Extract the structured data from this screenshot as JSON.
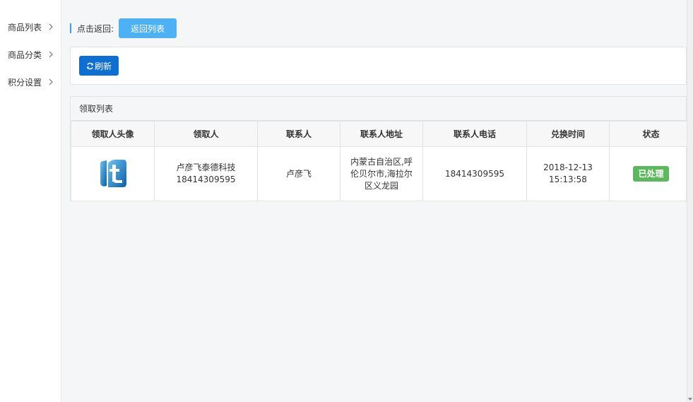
{
  "sidebar": {
    "items": [
      {
        "label": "商品列表"
      },
      {
        "label": "商品分类"
      },
      {
        "label": "积分设置"
      }
    ]
  },
  "back": {
    "label": "点击返回:",
    "button": "返回列表"
  },
  "toolbar": {
    "refresh": "刷新"
  },
  "list": {
    "title": "领取列表",
    "columns": [
      "领取人头像",
      "领取人",
      "联系人",
      "联系人地址",
      "联系人电话",
      "兑换时间",
      "状态"
    ],
    "rows": [
      {
        "recipient_name": "卢彦飞泰德科技",
        "recipient_phone": "18414309595",
        "contact": "卢彦飞",
        "address": "内蒙古自治区,呼伦贝尔市,海拉尔区义龙园",
        "phone": "18414309595",
        "date": "2018-12-13",
        "time": "15:13:58",
        "status": "已处理"
      }
    ]
  },
  "colors": {
    "back_button": "#4fb1f5",
    "refresh_button": "#0f6fd1",
    "status_done": "#5cb85c",
    "accent_bar": "#3a9fe8"
  }
}
